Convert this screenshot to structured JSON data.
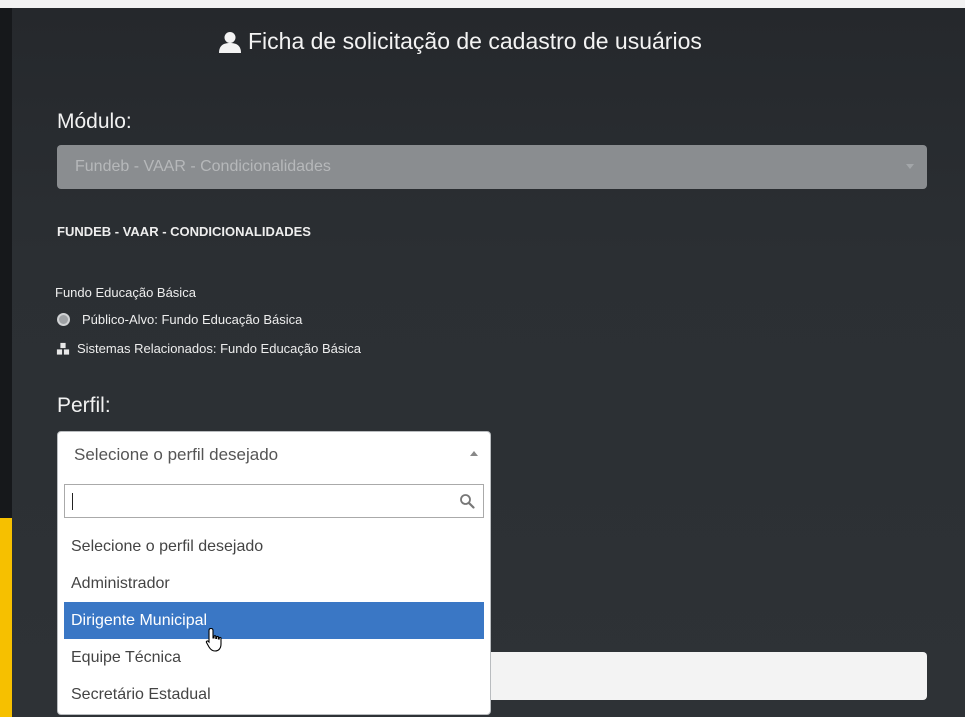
{
  "header": {
    "title": "Ficha de solicitação de cadastro de usuários",
    "icon": "user-icon"
  },
  "module": {
    "label": "Módulo:",
    "selected": "Fundeb - VAAR - Condicionalidades"
  },
  "module_info": {
    "name_caps": "FUNDEB - VAAR - CONDICIONALIDADES",
    "fund_name": "Fundo Educação Básica",
    "public_target": "Público-Alvo: Fundo Educação Básica",
    "related_systems": "Sistemas Relacionados: Fundo Educação Básica"
  },
  "profile": {
    "label": "Perfil:",
    "selected": "Selecione o perfil desejado",
    "search_value": "",
    "options": [
      "Selecione o perfil desejado",
      "Administrador",
      "Dirigente Municipal",
      "Equipe Técnica",
      "Secretário Estadual"
    ],
    "highlighted_index": 2
  },
  "colors": {
    "background": "#2b2f33",
    "highlight": "#3a77c5",
    "accent_strip": "#f6c000"
  }
}
